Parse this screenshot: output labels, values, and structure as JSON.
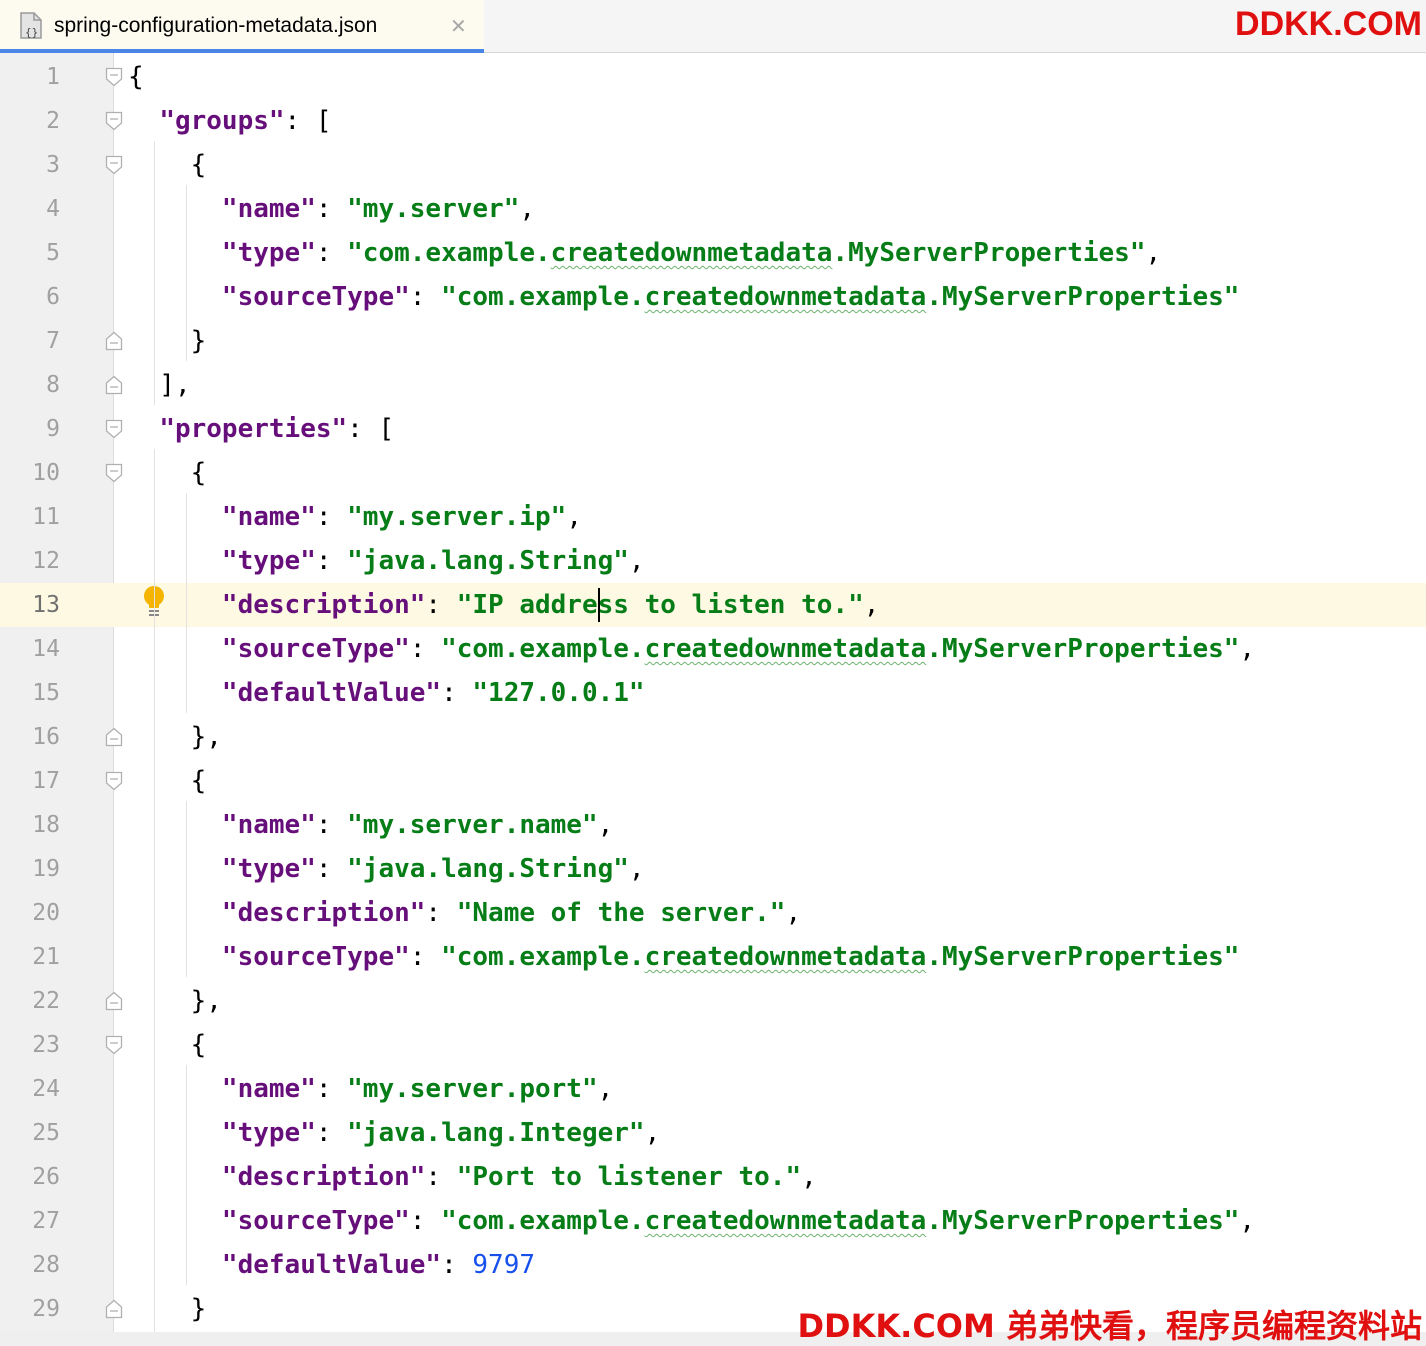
{
  "tab": {
    "title": "spring-configuration-metadata.json",
    "close_glyph": "✕",
    "icon": "json-file-icon"
  },
  "watermark": {
    "top": "DDKK.COM",
    "bottom": "DDKK.COM 弟弟快看，程序员编程资料站"
  },
  "editor": {
    "current_line": 13,
    "lines": [
      {
        "n": "1",
        "fold": "open",
        "tokens": [
          [
            "p",
            "{"
          ]
        ]
      },
      {
        "n": "2",
        "fold": "open",
        "tokens": [
          [
            "p",
            "  "
          ],
          [
            "k",
            "\"groups\""
          ],
          [
            "p",
            ": ["
          ]
        ]
      },
      {
        "n": "3",
        "fold": "open",
        "tokens": [
          [
            "p",
            "    {"
          ]
        ]
      },
      {
        "n": "4",
        "fold": "",
        "tokens": [
          [
            "p",
            "      "
          ],
          [
            "k",
            "\"name\""
          ],
          [
            "p",
            ": "
          ],
          [
            "s",
            "\"my.server\""
          ],
          [
            "p",
            ","
          ]
        ]
      },
      {
        "n": "5",
        "fold": "",
        "tokens": [
          [
            "p",
            "      "
          ],
          [
            "k",
            "\"type\""
          ],
          [
            "p",
            ": "
          ],
          [
            "s",
            "\"com.example."
          ],
          [
            "sw",
            "createdownmetadata"
          ],
          [
            "s",
            ".MyServerProperties\""
          ],
          [
            "p",
            ","
          ]
        ]
      },
      {
        "n": "6",
        "fold": "",
        "tokens": [
          [
            "p",
            "      "
          ],
          [
            "k",
            "\"sourceType\""
          ],
          [
            "p",
            ": "
          ],
          [
            "s",
            "\"com.example."
          ],
          [
            "sw",
            "createdownmetadata"
          ],
          [
            "s",
            ".MyServerProperties\""
          ]
        ]
      },
      {
        "n": "7",
        "fold": "close",
        "tokens": [
          [
            "p",
            "    }"
          ]
        ]
      },
      {
        "n": "8",
        "fold": "close",
        "tokens": [
          [
            "p",
            "  ],"
          ]
        ]
      },
      {
        "n": "9",
        "fold": "open",
        "tokens": [
          [
            "p",
            "  "
          ],
          [
            "k",
            "\"properties\""
          ],
          [
            "p",
            ": ["
          ]
        ]
      },
      {
        "n": "10",
        "fold": "open",
        "tokens": [
          [
            "p",
            "    {"
          ]
        ]
      },
      {
        "n": "11",
        "fold": "",
        "tokens": [
          [
            "p",
            "      "
          ],
          [
            "k",
            "\"name\""
          ],
          [
            "p",
            ": "
          ],
          [
            "s",
            "\"my.server.ip\""
          ],
          [
            "p",
            ","
          ]
        ]
      },
      {
        "n": "12",
        "fold": "",
        "tokens": [
          [
            "p",
            "      "
          ],
          [
            "k",
            "\"type\""
          ],
          [
            "p",
            ": "
          ],
          [
            "s",
            "\"java.lang.String\""
          ],
          [
            "p",
            ","
          ]
        ]
      },
      {
        "n": "13",
        "fold": "",
        "tokens": [
          [
            "p",
            "      "
          ],
          [
            "k",
            "\"description\""
          ],
          [
            "p",
            ": "
          ],
          [
            "s",
            "\"IP address to listen to.\""
          ],
          [
            "p",
            ","
          ]
        ]
      },
      {
        "n": "14",
        "fold": "",
        "tokens": [
          [
            "p",
            "      "
          ],
          [
            "k",
            "\"sourceType\""
          ],
          [
            "p",
            ": "
          ],
          [
            "s",
            "\"com.example."
          ],
          [
            "sw",
            "createdownmetadata"
          ],
          [
            "s",
            ".MyServerProperties\""
          ],
          [
            "p",
            ","
          ]
        ]
      },
      {
        "n": "15",
        "fold": "",
        "tokens": [
          [
            "p",
            "      "
          ],
          [
            "k",
            "\"defaultValue\""
          ],
          [
            "p",
            ": "
          ],
          [
            "s",
            "\"127.0.0.1\""
          ]
        ]
      },
      {
        "n": "16",
        "fold": "close",
        "tokens": [
          [
            "p",
            "    },"
          ]
        ]
      },
      {
        "n": "17",
        "fold": "open",
        "tokens": [
          [
            "p",
            "    {"
          ]
        ]
      },
      {
        "n": "18",
        "fold": "",
        "tokens": [
          [
            "p",
            "      "
          ],
          [
            "k",
            "\"name\""
          ],
          [
            "p",
            ": "
          ],
          [
            "s",
            "\"my.server.name\""
          ],
          [
            "p",
            ","
          ]
        ]
      },
      {
        "n": "19",
        "fold": "",
        "tokens": [
          [
            "p",
            "      "
          ],
          [
            "k",
            "\"type\""
          ],
          [
            "p",
            ": "
          ],
          [
            "s",
            "\"java.lang.String\""
          ],
          [
            "p",
            ","
          ]
        ]
      },
      {
        "n": "20",
        "fold": "",
        "tokens": [
          [
            "p",
            "      "
          ],
          [
            "k",
            "\"description\""
          ],
          [
            "p",
            ": "
          ],
          [
            "s",
            "\"Name of the server.\""
          ],
          [
            "p",
            ","
          ]
        ]
      },
      {
        "n": "21",
        "fold": "",
        "tokens": [
          [
            "p",
            "      "
          ],
          [
            "k",
            "\"sourceType\""
          ],
          [
            "p",
            ": "
          ],
          [
            "s",
            "\"com.example."
          ],
          [
            "sw",
            "createdownmetadata"
          ],
          [
            "s",
            ".MyServerProperties\""
          ]
        ]
      },
      {
        "n": "22",
        "fold": "close",
        "tokens": [
          [
            "p",
            "    },"
          ]
        ]
      },
      {
        "n": "23",
        "fold": "open",
        "tokens": [
          [
            "p",
            "    {"
          ]
        ]
      },
      {
        "n": "24",
        "fold": "",
        "tokens": [
          [
            "p",
            "      "
          ],
          [
            "k",
            "\"name\""
          ],
          [
            "p",
            ": "
          ],
          [
            "s",
            "\"my.server.port\""
          ],
          [
            "p",
            ","
          ]
        ]
      },
      {
        "n": "25",
        "fold": "",
        "tokens": [
          [
            "p",
            "      "
          ],
          [
            "k",
            "\"type\""
          ],
          [
            "p",
            ": "
          ],
          [
            "s",
            "\"java.lang.Integer\""
          ],
          [
            "p",
            ","
          ]
        ]
      },
      {
        "n": "26",
        "fold": "",
        "tokens": [
          [
            "p",
            "      "
          ],
          [
            "k",
            "\"description\""
          ],
          [
            "p",
            ": "
          ],
          [
            "s",
            "\"Port to listener to.\""
          ],
          [
            "p",
            ","
          ]
        ]
      },
      {
        "n": "27",
        "fold": "",
        "tokens": [
          [
            "p",
            "      "
          ],
          [
            "k",
            "\"sourceType\""
          ],
          [
            "p",
            ": "
          ],
          [
            "s",
            "\"com.example."
          ],
          [
            "sw",
            "createdownmetadata"
          ],
          [
            "s",
            ".MyServerProperties\""
          ],
          [
            "p",
            ","
          ]
        ]
      },
      {
        "n": "28",
        "fold": "",
        "tokens": [
          [
            "p",
            "      "
          ],
          [
            "k",
            "\"defaultValue\""
          ],
          [
            "p",
            ": "
          ],
          [
            "n",
            "9797"
          ]
        ]
      },
      {
        "n": "29",
        "fold": "close",
        "tokens": [
          [
            "p",
            "    }"
          ]
        ]
      }
    ]
  },
  "colors": {
    "key": "#660e7a",
    "string": "#067d17",
    "number": "#1750eb",
    "current_line": "#fdf9e3",
    "tab_underline": "#4a86e8",
    "watermark": "#e01010"
  }
}
